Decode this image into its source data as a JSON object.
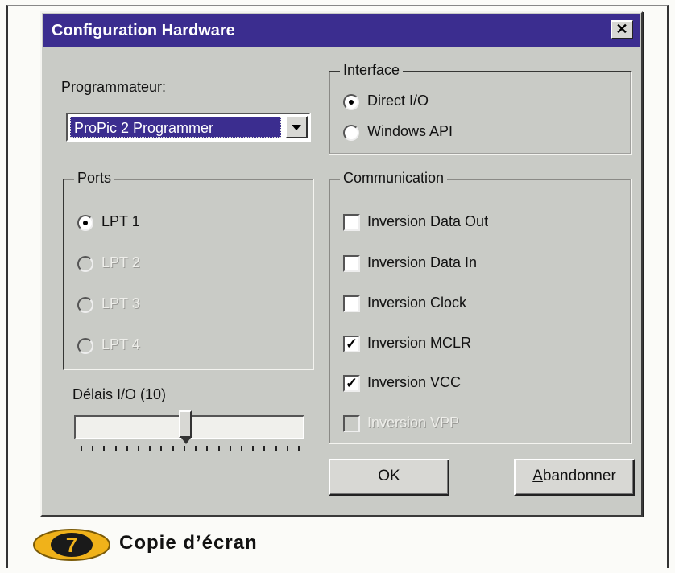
{
  "window": {
    "title": "Configuration Hardware",
    "close_glyph": "✕"
  },
  "programmer": {
    "label": "Programmateur:",
    "selected": "ProPic 2 Programmer"
  },
  "interface": {
    "title": "Interface",
    "options": [
      {
        "label": "Direct I/O",
        "selected": true,
        "enabled": true
      },
      {
        "label": "Windows API",
        "selected": false,
        "enabled": true
      }
    ]
  },
  "ports": {
    "title": "Ports",
    "options": [
      {
        "label": "LPT 1",
        "selected": true,
        "enabled": true
      },
      {
        "label": "LPT 2",
        "selected": false,
        "enabled": false
      },
      {
        "label": "LPT 3",
        "selected": false,
        "enabled": false
      },
      {
        "label": "LPT 4",
        "selected": false,
        "enabled": false
      }
    ]
  },
  "communication": {
    "title": "Communication",
    "options": [
      {
        "label": "Inversion Data Out",
        "checked": false,
        "enabled": true
      },
      {
        "label": "Inversion Data In",
        "checked": false,
        "enabled": true
      },
      {
        "label": "Inversion Clock",
        "checked": false,
        "enabled": true
      },
      {
        "label": "Inversion MCLR",
        "checked": true,
        "enabled": true
      },
      {
        "label": "Inversion VCC",
        "checked": true,
        "enabled": true
      },
      {
        "label": "Inversion VPP",
        "checked": false,
        "enabled": false
      }
    ]
  },
  "delay": {
    "label": "Délais I/O  (10)",
    "value_fraction": 0.5
  },
  "buttons": {
    "ok": "OK",
    "cancel": "Abandonner"
  },
  "caption": {
    "number": "7",
    "text": "Copie d’écran"
  },
  "colors": {
    "titlebar": "#3b2d8f",
    "dialog": "#c9cbc6",
    "badge": "#f0b21a"
  }
}
